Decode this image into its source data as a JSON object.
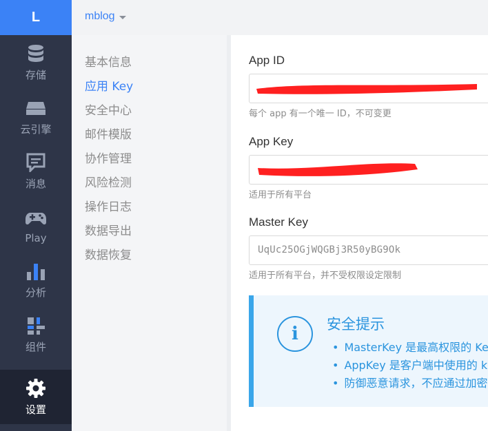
{
  "rail": {
    "logo": "L",
    "items": [
      {
        "label": "存储",
        "icon": "database-icon"
      },
      {
        "label": "云引擎",
        "icon": "server-icon"
      },
      {
        "label": "消息",
        "icon": "message-icon"
      },
      {
        "label": "Play",
        "icon": "gamepad-icon"
      },
      {
        "label": "分析",
        "icon": "bar-chart-icon"
      },
      {
        "label": "组件",
        "icon": "components-icon"
      },
      {
        "label": "设置",
        "icon": "gear-icon",
        "active": true
      }
    ]
  },
  "topbar": {
    "app_name": "mblog"
  },
  "subnav": {
    "items": [
      "基本信息",
      "应用 Key",
      "安全中心",
      "邮件模版",
      "协作管理",
      "风险检测",
      "操作日志",
      "数据导出",
      "数据恢复"
    ],
    "active_index": 1
  },
  "fields": {
    "app_id": {
      "label": "App ID",
      "hint": "每个 app 有一个唯一 ID，不可变更"
    },
    "app_key": {
      "label": "App Key",
      "hint": "适用于所有平台"
    },
    "master_key": {
      "label": "Master Key",
      "value": "UqUc25OGjWQGBj3R50yBG9Ok",
      "hint": "适用于所有平台，并不受权限设定限制"
    }
  },
  "tip": {
    "title": "安全提示",
    "items": [
      "MasterKey 是最高权限的 Ke",
      "AppKey 是客户端中使用的 k",
      "防御恶意请求，不应通过加密"
    ]
  },
  "colors": {
    "accent": "#3b82f6",
    "rail_bg": "#2e3548",
    "tip_blue": "#2a94de",
    "redaction": "#ff2020"
  }
}
